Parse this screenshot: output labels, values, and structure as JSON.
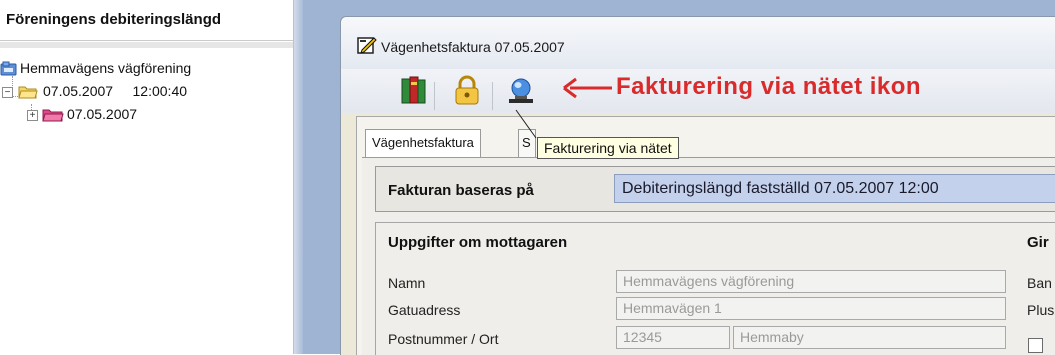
{
  "tree": {
    "title": "Föreningens debiteringslängd",
    "root_label": "Hemmavägens vägförening",
    "node1_label": "07.05.2007     12:00:40",
    "node2_label": "07.05.2007"
  },
  "window": {
    "title": "Vägenhetsfaktura  07.05.2007"
  },
  "annotation": {
    "text": "Fakturering via nätet ikon",
    "color": "#d92b2b"
  },
  "toolbar": {
    "icons": [
      "books-icon",
      "padlock-icon",
      "web-invoice-icon"
    ]
  },
  "tabs": [
    {
      "label": "Vägenhetsfaktura"
    },
    {
      "label": "S"
    }
  ],
  "tooltip": {
    "text": "Fakturering via nätet"
  },
  "basis": {
    "label": "Fakturan baseras på",
    "value": "Debiteringslängd fastställd  07.05.2007    12:00"
  },
  "recipient": {
    "heading": "Uppgifter om mottagaren",
    "name_label": "Namn",
    "name_value": "Hemmavägens vägförening",
    "street_label": "Gatuadress",
    "street_value": "Hemmavägen 1",
    "postal_label": "Postnummer / Ort",
    "postal_code": "12345",
    "city": "Hemmaby"
  },
  "giro": {
    "heading": "Gir",
    "bank_label": "Ban",
    "plus_label": "Plus"
  },
  "colors": {
    "selection": "#c3d1ec",
    "backdrop": "#9fb4d2",
    "window": "#ece9d8"
  }
}
